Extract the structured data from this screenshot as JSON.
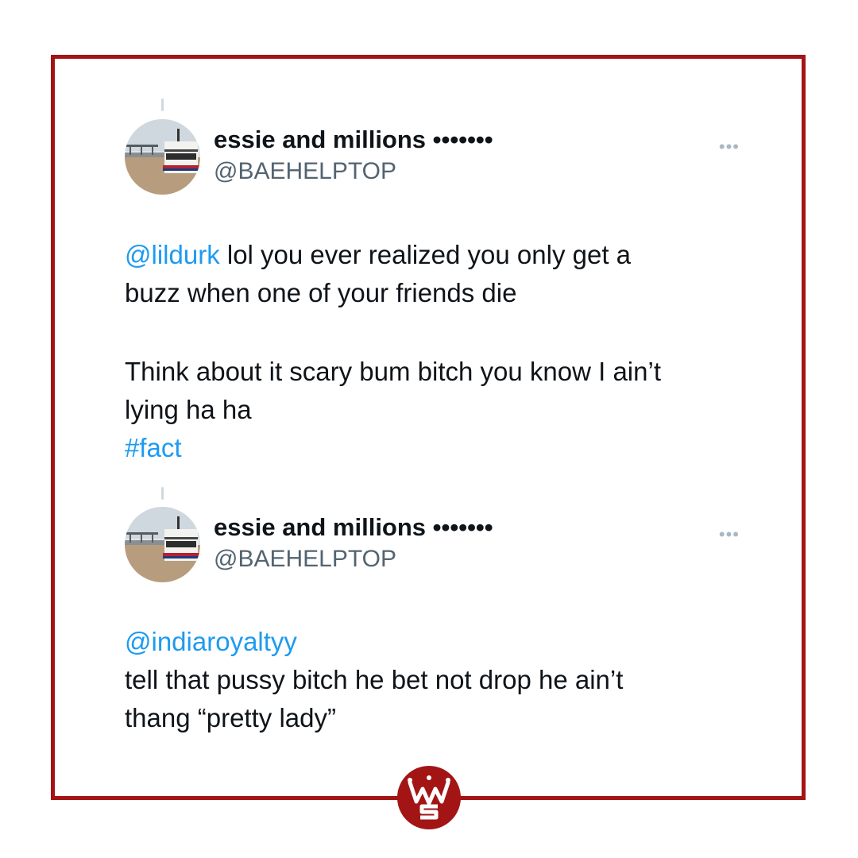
{
  "colors": {
    "frame": "#a31515",
    "link": "#1d9bf0",
    "handle": "#536471",
    "text": "#0f1419"
  },
  "tweets": [
    {
      "display_name": "essie and millions •••••••",
      "handle": "@BAEHELPTOP",
      "more_icon": "more-options-icon",
      "mention": "@lildurk",
      "line1_rest": " lol you ever realized you only get a",
      "line2": "buzz when one of your friends die",
      "line3": "Think about it scary bum bitch you know I ain’t",
      "line4": "lying ha ha",
      "hashtag": "#fact"
    },
    {
      "display_name": "essie and millions •••••••",
      "handle": "@BAEHELPTOP",
      "more_icon": "more-options-icon",
      "mention": "@indiaroyaltyy",
      "line2": "tell that pussy bitch he bet not drop he ain’t",
      "line3": "thang “pretty lady”"
    }
  ],
  "logo": {
    "icon": "worldstar-crown-logo"
  }
}
